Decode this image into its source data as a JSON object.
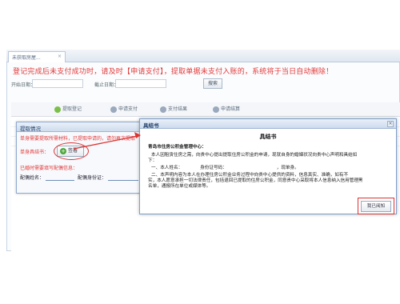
{
  "tabs": [
    {
      "label": "未获取房屋...",
      "close": "×"
    }
  ],
  "warning": "登记完成后未支付成功时，请及时【申请支付】，提取单据未支付入账的，系统将于当日自动删除！",
  "filters": {
    "start_label": "开始日期：",
    "end_label": "截止日期：",
    "search_label": "搜索"
  },
  "toolbar": {
    "items": [
      "提取登记",
      "申请支付",
      "支付结果",
      "申请结算"
    ]
  },
  "left_dialog": {
    "title": "提取情况",
    "red_line1": "单身需要提取所需材料，已提取申请的，请勿再次提取",
    "red_line2": "已婚需要提取所需材料：已提取申请的",
    "single_label": "单身具结书：",
    "ok_label": "签署",
    "married_label": "已婚时需要填写配偶信息：",
    "spouse_name_label": "配偶姓名：",
    "spouse_id_label": "配偶身份证："
  },
  "main_dialog": {
    "title": "具结书",
    "close": "×",
    "heading": "具结书",
    "to": "青岛市住房公积金管理中心：",
    "para1": "本人因租赁住房之需，向贵中心提出提取住房公积金的申请，现就自身的婚姻状况向贵中心声明和具结如",
    "para1b": "下：",
    "item1_prefix": "一、本人姓名：",
    "item1_mid": "身份证号码：",
    "item1_suffix": "，现单身。",
    "item2": "二、本声明内容为本人在办理住房公积金业务过程中向贵中心提供的资料，信息真实、准确，如有不",
    "item2b": "实，本人愿意承担一切法律责任，包括退回已提取的住房公积金，同意贵中心采取将本人信息纳入信用管理黑",
    "item2c": "名单，通报所在单位或媒体等。",
    "print_label": "我已阅知"
  },
  "colors": {
    "warning": "#e23a3a",
    "annotation": "#dd3333",
    "dialog_border": "#7e9fcc"
  }
}
